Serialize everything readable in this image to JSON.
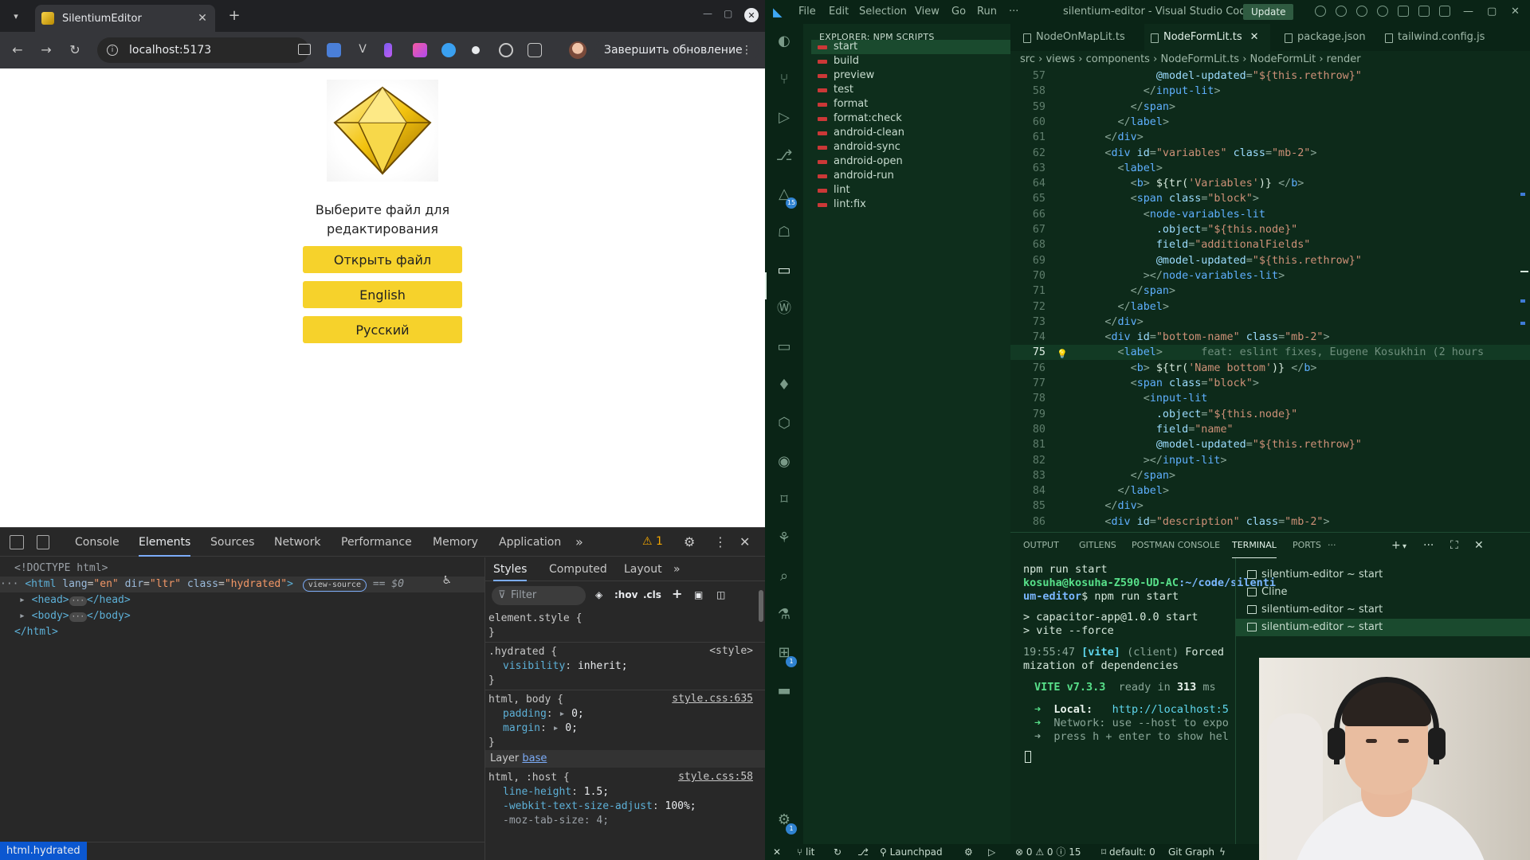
{
  "browser": {
    "tab_title": "SilentiumEditor",
    "url": "localhost:5173",
    "update_button": "Завершить обновление",
    "page": {
      "prompt_line1": "Выберите файл для",
      "prompt_line2": "редактирования",
      "open_file": "Открыть файл",
      "english": "English",
      "russian": "Русский"
    },
    "devtools": {
      "tabs": [
        "Console",
        "Elements",
        "Sources",
        "Network",
        "Performance",
        "Memory",
        "Application"
      ],
      "warning_count": "1",
      "elements": {
        "doctype": "<!DOCTYPE html>",
        "html_open": "html",
        "lang_attr": "lang",
        "lang_val": "\"en\"",
        "dir_attr": "dir",
        "dir_val": "\"ltr\"",
        "class_attr": "class",
        "class_val": "\"hydrated\"",
        "view_source": "view-source",
        "dollar0": "== $0",
        "head": "<head>",
        "head_close": "</head>",
        "body": "<body>",
        "body_close": "</body>",
        "html_close": "</html>",
        "breadcrumb": "html.hydrated"
      },
      "styles": {
        "tabs": [
          "Styles",
          "Computed",
          "Layout"
        ],
        "filter_placeholder": "Filter",
        "hov": ":hov",
        "cls": ".cls",
        "rule1_sel": "element.style {",
        "close": "}",
        "rule2_sel": ".hydrated {",
        "rule2_src": "<style>",
        "rule2_prop": "visibility",
        "rule2_val": "inherit;",
        "rule3_sel": "html, body {",
        "rule3_src": "style.css:635",
        "rule3_p1": "padding",
        "rule3_v1": "0;",
        "rule3_p2": "margin",
        "rule3_v2": "0;",
        "layer_label": "Layer",
        "layer_link": "base",
        "rule4_sel": "html, :host {",
        "rule4_src": "style.css:58",
        "rule4_p1": "line-height",
        "rule4_v1": "1.5;",
        "rule4_p2": "-webkit-text-size-adjust",
        "rule4_v2": "100%;",
        "rule4_p3": "-moz-tab-size",
        "rule4_v3": "4;"
      }
    }
  },
  "vscode": {
    "menu": [
      "File",
      "Edit",
      "Selection",
      "View",
      "Go",
      "Run",
      "···"
    ],
    "window_title": "silentium-editor - Visual Studio Code",
    "update_label": "Update",
    "explorer_title": "EXPLORER: NPM SCRIPTS",
    "scripts": [
      "start",
      "build",
      "preview",
      "test",
      "format",
      "format:check",
      "android-clean",
      "android-sync",
      "android-open",
      "android-run",
      "lint",
      "lint:fix"
    ],
    "tabs": [
      "NodeOnMapLit.ts",
      "NodeFormLit.ts",
      "package.json",
      "tailwind.config.js"
    ],
    "breadcrumb": [
      "src",
      "views",
      "components",
      "NodeFormLit.ts",
      "NodeFormLit",
      "render"
    ],
    "badges": {
      "warnings": "15",
      "extensions": "1",
      "settings": "1"
    },
    "code_lines": [
      {
        "n": "57",
        "parts": [
          [
            "at",
            "              @model-updated"
          ],
          [
            "br",
            "="
          ],
          [
            "st",
            "\"${this.rethrow}\""
          ]
        ]
      },
      {
        "n": "58",
        "parts": [
          [
            "br",
            "            </"
          ],
          [
            "tag",
            "input-lit"
          ],
          [
            "br",
            ">"
          ]
        ]
      },
      {
        "n": "59",
        "parts": [
          [
            "br",
            "          </"
          ],
          [
            "tag",
            "span"
          ],
          [
            "br",
            ">"
          ]
        ]
      },
      {
        "n": "60",
        "parts": [
          [
            "br",
            "        </"
          ],
          [
            "tag",
            "label"
          ],
          [
            "br",
            ">"
          ]
        ]
      },
      {
        "n": "61",
        "parts": [
          [
            "br",
            "      </"
          ],
          [
            "tag",
            "div"
          ],
          [
            "br",
            ">"
          ]
        ]
      },
      {
        "n": "62",
        "parts": [
          [
            "br",
            "      <"
          ],
          [
            "tag",
            "div"
          ],
          [
            "at",
            " id"
          ],
          [
            "br",
            "="
          ],
          [
            "st",
            "\"variables\""
          ],
          [
            "at",
            " class"
          ],
          [
            "br",
            "="
          ],
          [
            "st",
            "\"mb-2\""
          ],
          [
            "br",
            ">"
          ]
        ]
      },
      {
        "n": "63",
        "parts": [
          [
            "br",
            "        <"
          ],
          [
            "tag",
            "label"
          ],
          [
            "br",
            ">"
          ]
        ]
      },
      {
        "n": "64",
        "parts": [
          [
            "br",
            "          <"
          ],
          [
            "tag",
            "b"
          ],
          [
            "br",
            ">"
          ],
          [
            "tx",
            " ${tr("
          ],
          [
            "st",
            "'Variables'"
          ],
          [
            "tx",
            ")} "
          ],
          [
            "br",
            "</"
          ],
          [
            "tag",
            "b"
          ],
          [
            "br",
            ">"
          ]
        ]
      },
      {
        "n": "65",
        "parts": [
          [
            "br",
            "          <"
          ],
          [
            "tag",
            "span"
          ],
          [
            "at",
            " class"
          ],
          [
            "br",
            "="
          ],
          [
            "st",
            "\"block\""
          ],
          [
            "br",
            ">"
          ]
        ]
      },
      {
        "n": "66",
        "parts": [
          [
            "br",
            "            <"
          ],
          [
            "tag",
            "node-variables-lit"
          ]
        ]
      },
      {
        "n": "67",
        "parts": [
          [
            "at",
            "              .object"
          ],
          [
            "br",
            "="
          ],
          [
            "st",
            "\"${this.node}\""
          ]
        ]
      },
      {
        "n": "68",
        "parts": [
          [
            "at",
            "              field"
          ],
          [
            "br",
            "="
          ],
          [
            "st",
            "\"additionalFields\""
          ]
        ]
      },
      {
        "n": "69",
        "parts": [
          [
            "at",
            "              @model-updated"
          ],
          [
            "br",
            "="
          ],
          [
            "st",
            "\"${this.rethrow}\""
          ]
        ]
      },
      {
        "n": "70",
        "parts": [
          [
            "br",
            "            ></"
          ],
          [
            "tag",
            "node-variables-lit"
          ],
          [
            "br",
            ">"
          ]
        ]
      },
      {
        "n": "71",
        "parts": [
          [
            "br",
            "          </"
          ],
          [
            "tag",
            "span"
          ],
          [
            "br",
            ">"
          ]
        ]
      },
      {
        "n": "72",
        "parts": [
          [
            "br",
            "        </"
          ],
          [
            "tag",
            "label"
          ],
          [
            "br",
            ">"
          ]
        ]
      },
      {
        "n": "73",
        "parts": [
          [
            "br",
            "      </"
          ],
          [
            "tag",
            "div"
          ],
          [
            "br",
            ">"
          ]
        ]
      },
      {
        "n": "74",
        "parts": [
          [
            "br",
            "      <"
          ],
          [
            "tag",
            "div"
          ],
          [
            "at",
            " id"
          ],
          [
            "br",
            "="
          ],
          [
            "st",
            "\"bottom-name\""
          ],
          [
            "at",
            " class"
          ],
          [
            "br",
            "="
          ],
          [
            "st",
            "\"mb-2\""
          ],
          [
            "br",
            ">"
          ]
        ]
      },
      {
        "n": "75",
        "cur": true,
        "parts": [
          [
            "br",
            "        <"
          ],
          [
            "tag",
            "label"
          ],
          [
            "br",
            ">"
          ],
          [
            "blame",
            "      feat: eslint fixes, Eugene Kosukhin (2 hours"
          ]
        ]
      },
      {
        "n": "76",
        "parts": [
          [
            "br",
            "          <"
          ],
          [
            "tag",
            "b"
          ],
          [
            "br",
            ">"
          ],
          [
            "tx",
            " ${tr("
          ],
          [
            "st",
            "'Name bottom'"
          ],
          [
            "tx",
            ")} "
          ],
          [
            "br",
            "</"
          ],
          [
            "tag",
            "b"
          ],
          [
            "br",
            ">"
          ]
        ]
      },
      {
        "n": "77",
        "parts": [
          [
            "br",
            "          <"
          ],
          [
            "tag",
            "span"
          ],
          [
            "at",
            " class"
          ],
          [
            "br",
            "="
          ],
          [
            "st",
            "\"block\""
          ],
          [
            "br",
            ">"
          ]
        ]
      },
      {
        "n": "78",
        "parts": [
          [
            "br",
            "            <"
          ],
          [
            "tag",
            "input-lit"
          ]
        ]
      },
      {
        "n": "79",
        "parts": [
          [
            "at",
            "              .object"
          ],
          [
            "br",
            "="
          ],
          [
            "st",
            "\"${this.node}\""
          ]
        ]
      },
      {
        "n": "80",
        "parts": [
          [
            "at",
            "              field"
          ],
          [
            "br",
            "="
          ],
          [
            "st",
            "\"name\""
          ]
        ]
      },
      {
        "n": "81",
        "parts": [
          [
            "at",
            "              @model-updated"
          ],
          [
            "br",
            "="
          ],
          [
            "st",
            "\"${this.rethrow}\""
          ]
        ]
      },
      {
        "n": "82",
        "parts": [
          [
            "br",
            "            ></"
          ],
          [
            "tag",
            "input-lit"
          ],
          [
            "br",
            ">"
          ]
        ]
      },
      {
        "n": "83",
        "parts": [
          [
            "br",
            "          </"
          ],
          [
            "tag",
            "span"
          ],
          [
            "br",
            ">"
          ]
        ]
      },
      {
        "n": "84",
        "parts": [
          [
            "br",
            "        </"
          ],
          [
            "tag",
            "label"
          ],
          [
            "br",
            ">"
          ]
        ]
      },
      {
        "n": "85",
        "parts": [
          [
            "br",
            "      </"
          ],
          [
            "tag",
            "div"
          ],
          [
            "br",
            ">"
          ]
        ]
      },
      {
        "n": "86",
        "parts": [
          [
            "br",
            "      <"
          ],
          [
            "tag",
            "div"
          ],
          [
            "at",
            " id"
          ],
          [
            "br",
            "="
          ],
          [
            "st",
            "\"description\""
          ],
          [
            "at",
            " class"
          ],
          [
            "br",
            "="
          ],
          [
            "st",
            "\"mb-2\""
          ],
          [
            "br",
            ">"
          ]
        ]
      }
    ],
    "panel_tabs": [
      "OUTPUT",
      "GITLENS",
      "POSTMAN CONSOLE",
      "TERMINAL",
      "PORTS",
      "···"
    ],
    "terminal": {
      "l1": "npm run start",
      "user": "kosuha@kosuha-Z590-UD-AC",
      "path1": ":~/code/silenti",
      "path2": "um-editor",
      "cmd": "$ npm run start",
      "l4": "> capacitor-app@1.0.0 start",
      "l5": "> vite --force",
      "time": "19:55:47",
      "vite_tag": "[vite]",
      "client": "(client)",
      "forced": " Forced",
      "l7": "mization of dependencies",
      "vite_ver": "VITE v7.3.3",
      "ready": "ready in",
      "ms": "313",
      "ms_unit": "ms",
      "local_label": "Local:",
      "local_url": "http://localhost:5",
      "net_label": "Network:",
      "net_text": "use --host to expo",
      "help": "press h + enter to show hel"
    },
    "terminals": [
      "silentium-editor ~ start",
      "Cline",
      "silentium-editor ~ start",
      "silentium-editor ~ start"
    ],
    "status": {
      "branch": "lit",
      "launchpad": "Launchpad",
      "errors": "0",
      "warnings": "0",
      "info": "15",
      "default": "default: 0",
      "git_graph": "Git Graph"
    }
  }
}
